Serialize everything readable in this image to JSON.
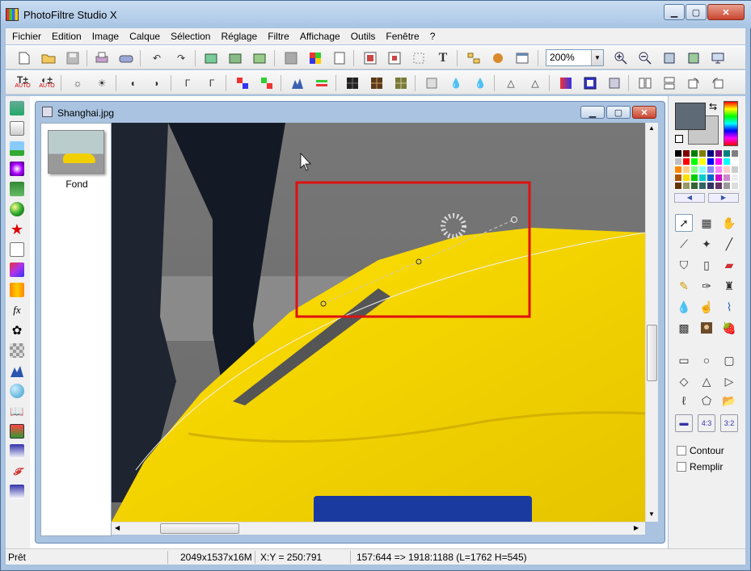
{
  "window": {
    "title": "PhotoFiltre Studio X",
    "min_label": "▁",
    "max_label": "▢",
    "close_label": "✕"
  },
  "menu": [
    "Fichier",
    "Edition",
    "Image",
    "Calque",
    "Sélection",
    "Réglage",
    "Filtre",
    "Affichage",
    "Outils",
    "Fenêtre",
    "?"
  ],
  "toolbar": {
    "zoom_value": "200%",
    "text_tool_label": "T"
  },
  "toolbar2": {
    "auto_label": "AUTO"
  },
  "document": {
    "title": "Shanghai.jpg"
  },
  "layers": [
    {
      "label": "Fond"
    }
  ],
  "right_panel": {
    "contour_label": "Contour",
    "remplir_label": "Remplir",
    "ratio_43": "4:3",
    "ratio_32": "3:2"
  },
  "status": {
    "state": "Prêt",
    "dimensions": "2049x1537x16M",
    "coords": "X:Y = 250:791",
    "selection": "157:644 => 1918:1188 (L=1762  H=545)"
  },
  "colors": {
    "foreground": "#5e6a76",
    "background": "#c8c8c8",
    "car": "#f2d000",
    "selection_rect": "#e01010"
  }
}
